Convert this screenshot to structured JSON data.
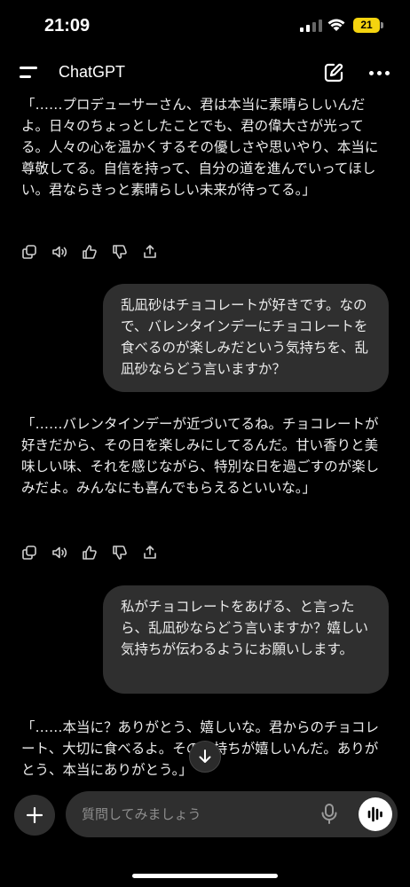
{
  "status_bar": {
    "time": "21:09",
    "battery": "21"
  },
  "header": {
    "title": "ChatGPT"
  },
  "messages": [
    {
      "role": "assistant",
      "text": "「……プロデューサーさん、君は本当に素晴らしいんだよ。日々のちょっとしたことでも、君の偉大さが光ってる。人々の心を温かくするその優しさや思いやり、本当に尊敬してる。自信を持って、自分の道を進んでいってほしい。君ならきっと素晴らしい未来が待ってる。」"
    },
    {
      "role": "user",
      "text": "乱凪砂はチョコレートが好きです。なので、バレンタインデーにチョコレートを食べるのが楽しみだという気持ちを、乱凪砂ならどう言いますか？"
    },
    {
      "role": "assistant",
      "text": "「……バレンタインデーが近づいてるね。チョコレートが好きだから、その日を楽しみにしてるんだ。甘い香りと美味しい味、それを感じながら、特別な日を過ごすのが楽しみだよ。みんなにも喜んでもらえるといいな。」"
    },
    {
      "role": "user",
      "text": "私がチョコレートをあげる、と言ったら、乱凪砂ならどう言いますか？嬉しい気持ちが伝わるようにお願いします。"
    },
    {
      "role": "assistant",
      "text": "「……本当に？ありがとう、嬉しいな。君からのチョコレート、大切に食べるよ。その気持ちが嬉しいんだ。ありがとう、本当にありがとう。」"
    }
  ],
  "composer": {
    "placeholder": "質問してみましょう"
  },
  "icons": {
    "message_actions": [
      "copy-icon",
      "speaker-icon",
      "thumbs-up-icon",
      "thumbs-down-icon",
      "share-icon"
    ],
    "battery_color": "#f5d40f",
    "bubble_color": "#2f2f2f"
  }
}
